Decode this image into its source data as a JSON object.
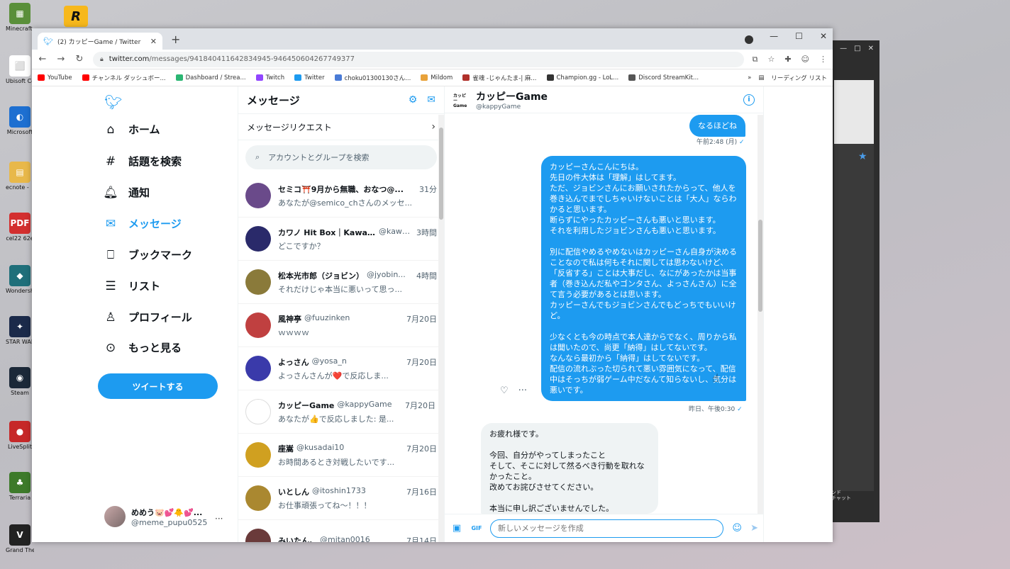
{
  "desktop": {
    "icons": [
      {
        "label": "Minecraft Launcher",
        "color": "#5a8f3a",
        "glyph": "▦"
      },
      {
        "label": "Ubisoft Con",
        "color": "#ffffff",
        "glyph": "⬜"
      },
      {
        "label": "Microsoft",
        "color": "#1d6fd1",
        "glyph": "◐"
      },
      {
        "label": "ecnote - リンク",
        "color": "#e8b84a",
        "glyph": "▤"
      },
      {
        "label": "cel22 62e",
        "color": "#d32f2f",
        "glyph": "PDF"
      },
      {
        "label": "Wondersh Filmora",
        "color": "#1f6f7a",
        "glyph": "◆"
      },
      {
        "label": "STAR WARS",
        "color": "#1b2a4a",
        "glyph": "✦"
      },
      {
        "label": "Steam",
        "color": "#1b2838",
        "glyph": "◉"
      },
      {
        "label": "LiveSplit",
        "color": "#c62828",
        "glyph": "●"
      },
      {
        "label": "Terraria",
        "color": "#3d7a2a",
        "glyph": "♣"
      },
      {
        "label": "Grand Theft Auto V",
        "color": "#222222",
        "glyph": "V"
      }
    ],
    "r_icon": "R"
  },
  "browser": {
    "tab_title": "(2) カッピーGame / Twitter",
    "url_host": "twitter.com",
    "url_path": "/messages/941840411642834945-946450604267749377",
    "bookmarks": [
      "YouTube",
      "チャンネル ダッシュボー...",
      "Dashboard / Strea...",
      "Twitch",
      "Twitter",
      "choku01300130さん...",
      "Mildom",
      "雀魂 -じゃんたま-| 麻...",
      "Champion.gg - LoL...",
      "Discord StreamKit..."
    ],
    "bookmark_colors": [
      "#ff0000",
      "#ff0000",
      "#2bb673",
      "#9146ff",
      "#1d9bf0",
      "#4a7bd6",
      "#e8a23a",
      "#b0302a",
      "#333333",
      "#555555"
    ],
    "reading_list": "リーディング リスト"
  },
  "nav": {
    "items": [
      {
        "label": "ホーム",
        "icon": "home-icon",
        "glyph": "⌂"
      },
      {
        "label": "話題を検索",
        "icon": "hashtag-icon",
        "glyph": "#"
      },
      {
        "label": "通知",
        "icon": "bell-icon",
        "glyph": "🔔︎"
      },
      {
        "label": "メッセージ",
        "icon": "mail-icon",
        "glyph": "✉"
      },
      {
        "label": "ブックマーク",
        "icon": "bookmark-icon",
        "glyph": "⎕"
      },
      {
        "label": "リスト",
        "icon": "list-icon",
        "glyph": "☰"
      },
      {
        "label": "プロフィール",
        "icon": "person-icon",
        "glyph": "♙"
      },
      {
        "label": "もっと見る",
        "icon": "more-icon",
        "glyph": "⊙"
      }
    ],
    "tweet_button": "ツイートする",
    "user_name": "めめう🐷💕🐥💕...",
    "user_handle": "@meme_pupu0525"
  },
  "messages": {
    "title": "メッセージ",
    "requests": "メッセージリクエスト",
    "search_placeholder": "アカウントとグループを検索",
    "conversations": [
      {
        "name": "セミコ⛩️9月から無職、おなつ@...",
        "handle": "",
        "time": "31分",
        "preview": "あなたが@semico_chさんのメッセ...",
        "color": "#6a4a8a"
      },
      {
        "name": "カワノ Hit Box｜Kawano",
        "handle": "@kawa...",
        "time": "3時間",
        "preview": "どこですか？",
        "color": "#2a2a6a"
      },
      {
        "name": "松本光市郎（ジョビン）",
        "handle": "@jyobin...",
        "time": "4時間",
        "preview": "それだけじゃ本当に悪いって思っ...",
        "color": "#8a7a3a"
      },
      {
        "name": "風神亭",
        "handle": "@fuuzinken",
        "time": "7月20日",
        "preview": "ｗｗｗｗ",
        "color": "#c04040"
      },
      {
        "name": "よっさん",
        "handle": "@yosa_n",
        "time": "7月20日",
        "preview": "よっさんさんが❤️で反応しま...",
        "color": "#3a3aaa"
      },
      {
        "name": "カッピーGame",
        "handle": "@kappyGame",
        "time": "7月20日",
        "preview": "あなたが👍で反応しました: 是...",
        "color": "#ffffff"
      },
      {
        "name": "座嵩",
        "handle": "@kusadai10",
        "time": "7月20日",
        "preview": "お時間あるとき対戦したいです...",
        "color": "#d0a020"
      },
      {
        "name": "いとしん",
        "handle": "@itoshin1733",
        "time": "7月16日",
        "preview": "お仕事頑張ってね～！！！",
        "color": "#aa8830"
      },
      {
        "name": "みいたん。",
        "handle": "@mitan0016",
        "time": "7月14日",
        "preview": "",
        "color": "#6a3a3a"
      }
    ]
  },
  "conversation": {
    "name": "カッピーGame",
    "handle": "@kappyGame",
    "logo_text": "カッピー Game",
    "msg1": "なるほどね",
    "msg1_time": "午前2:48 (月)",
    "msg2": "カッピーさんこんにちは。\n先日の件大体は「理解」はしてます。\nただ、ジョビンさんにお願いされたからって、他人を巻き込んでまでしちゃいけないことは「大人」ならわかると思います。\n断らずにやったカッピーさんも悪いと思います。\nそれを利用したジョビンさんも悪いと思います。\n\n別に配信やめるやめないはカッピーさん自身が決めることなので私は何もそれに関しては思わないけど、「反省する」ことは大事だし、なにがあったかは当事者（巻き込んだ私やゴンタさん、よっさんさん）に全て言う必要があるとは思います。\nカッピーさんでもジョビンさんでもどっちでもいいけど。\n\n少なくとも今の時点で本人達からでなく、周りから私は聞いたので、尚更「納得」はしてないです。\nなんなら最初から「納得」はしてないです。\n配信の流れぶった切られて悪い雰囲気になって、配信中はそっちが弱ゲーム中だなんて知らないし、気分は悪いです。",
    "msg2_time": "昨日、午後0:30",
    "msg3": "お疲れ様です。\n\n今回、自分がやってしまったこと\nそして、そこに対して然るべき行動を取れなかったこと。\n改めてお詫びさせてください。\n\n本当に申し訳ございませんでした。",
    "composer_placeholder": "新しいメッセージを作成"
  },
  "right_window": {
    "chat_label": "ンド\nチャット"
  }
}
